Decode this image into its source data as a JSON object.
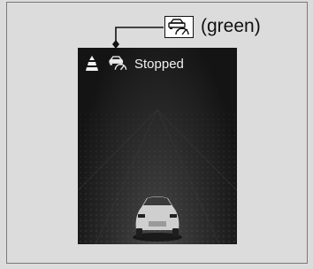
{
  "callout": {
    "label": "(green)",
    "icon": "acc-vehicle-meter-icon"
  },
  "display": {
    "status_text": "Stopped",
    "icons": [
      "lane-cone-icon",
      "acc-vehicle-meter-icon"
    ]
  },
  "colors": {
    "display_background": "#141414",
    "text_on_display": "#f2f2f2",
    "page_background": "#dcdcdc"
  }
}
